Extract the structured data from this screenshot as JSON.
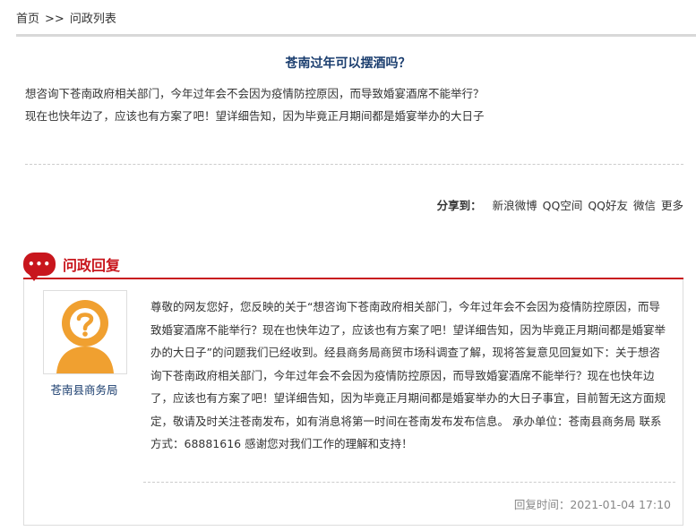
{
  "breadcrumb": {
    "home": "首页",
    "sep": ">>",
    "current": "问政列表"
  },
  "question": {
    "title": "苍南过年可以摆酒吗？",
    "line1": "想咨询下苍南政府相关部门，今年过年会不会因为疫情防控原因，而导致婚宴酒席不能举行？",
    "line2": "现在也快年边了，应该也有方案了吧！望详细告知，因为毕竟正月期间都是婚宴举办的大日子"
  },
  "share": {
    "label": "分享到：",
    "targets": [
      "新浪微博",
      "QQ空间",
      "QQ好友",
      "微信",
      "更多"
    ]
  },
  "reply": {
    "heading": "问政回复",
    "icon_dots": "•••",
    "department": "苍南县商务局",
    "body": "尊敬的网友您好，您反映的关于“想咨询下苍南政府相关部门，今年过年会不会因为疫情防控原因，而导致婚宴酒席不能举行？现在也快年边了，应该也有方案了吧！望详细告知，因为毕竟正月期间都是婚宴举办的大日子”的问题我们已经收到。经县商务局商贸市场科调查了解，现将答复意见回复如下：关于想咨询下苍南政府相关部门，今年过年会不会因为疫情防控原因，而导致婚宴酒席不能举行？现在也快年边了，应该也有方案了吧！望详细告知，因为毕竟正月期间都是婚宴举办的大日子事宜，目前暂无这方面规定，敬请及时关注苍南发布，如有消息将第一时间在苍南发布发布信息。 承办单位：苍南县商务局 联系方式：68881616 感谢您对我们工作的理解和支持！",
    "time": "回复时间：2021-01-04 17:10"
  },
  "colors": {
    "accent": "#c8161d",
    "title": "#1a3d6e",
    "avatar": "#f0a030"
  }
}
